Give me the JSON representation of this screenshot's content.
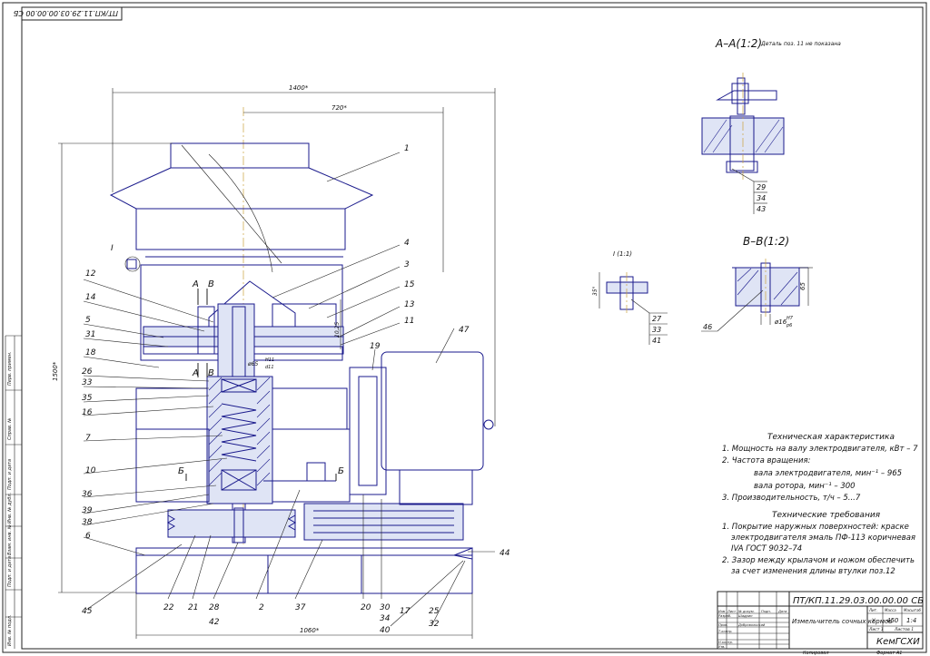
{
  "drawing": {
    "stamp_rotated": "ПТ/КП.11.29.03.00.00.00 СБ",
    "designation": "ПТ/КП.11.29.03.00.00.00 СБ",
    "title": "Измельчитель сочных кормов",
    "organization": "КемГСХИ",
    "mass": "450",
    "scale": "1:4",
    "sheet": "Лист 1",
    "sheets": "Листов 1",
    "copied": "Копировал",
    "format": "Формат А1"
  },
  "title_block": {
    "col_headers": [
      "Изм",
      "Лист",
      "№ докум.",
      "Подп.",
      "Дата"
    ],
    "row_roles": [
      "Разраб.",
      "Пров.",
      "Т.контр.",
      "Н.контр.",
      "Утв."
    ],
    "row_names": [
      "Шадрин",
      "Добровольский"
    ],
    "lit_label": "Лит.",
    "mass_label": "Масса",
    "scale_label": "Масштаб",
    "lit_value": "У"
  },
  "left_strip": [
    "Перв. примен.",
    "Справ. №",
    "Подп. и дата",
    "Инв. № дубл.",
    "Взам. инв. №",
    "Подп. и дата",
    "Инв. № подл."
  ],
  "dimensions": {
    "total_width": "1400*",
    "half_width": "720*",
    "height": "1500*",
    "base_width": "1060*",
    "gap": "10,25",
    "fit_d": "ø65",
    "fit_h": "H11",
    "fit_d2": "d11"
  },
  "sections": {
    "aa_title": "А–А(1:2)",
    "aa_note": "Деталь поз. 11 не показана",
    "aa_labels": [
      "29",
      "34",
      "43"
    ],
    "bb_title": "В–В(1:2)",
    "bb_dim": "ø16",
    "bb_fit_h": "H7",
    "bb_fit_r": "р6",
    "bb_side": "65",
    "bb_label": "46",
    "detail_title": "I (1:1)",
    "detail_dim": "35°",
    "detail_labels": [
      "27",
      "33",
      "41"
    ]
  },
  "section_marks": [
    "А",
    "В",
    "А",
    "В",
    "Б",
    "Б",
    "I"
  ],
  "positions_left": [
    "12",
    "14",
    "5",
    "31",
    "18",
    "26",
    "33",
    "35",
    "16",
    "7",
    "10",
    "36",
    "39",
    "38",
    "6"
  ],
  "positions_right": [
    "1",
    "4",
    "3",
    "15",
    "13",
    "11",
    "19",
    "47",
    "44"
  ],
  "positions_bottom": [
    "45",
    "22",
    "21",
    "28",
    "42",
    "2",
    "37",
    "20",
    "30",
    "34",
    "40",
    "17",
    "25",
    "32"
  ],
  "specs": {
    "title": "Техническая характеристика",
    "line1": "1. Мощность на валу электродвигателя, кВт – 7",
    "line2": "2. Частота вращения:",
    "line3": "вала электродвигателя, мин⁻¹ – 965",
    "line4": "вала ротора, мин⁻¹                  – 300",
    "line5": "3. Производительность, т/ч                – 5...7"
  },
  "requirements": {
    "title": "Технические требования",
    "line1": "1. Покрытие наружных поверхностей: краске",
    "line2": "электродвигателя эмаль ПФ-113 коричневая",
    "line3": "IVA ГОСТ 9032–74",
    "line4": "2. Зазор между крылачом и ножом обеспечить",
    "line5": "за счет изменения длины втулки поз.12"
  }
}
